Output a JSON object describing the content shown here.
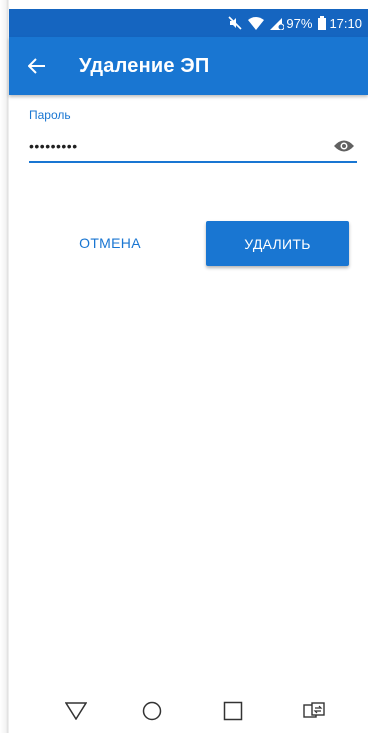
{
  "status_bar": {
    "battery_percent": "97%",
    "time": "17:10",
    "icons": [
      "mute-icon",
      "wifi-icon",
      "sim-icon",
      "battery-icon"
    ]
  },
  "app_bar": {
    "title": "Удаление ЭП",
    "back_icon": "arrow-back-icon"
  },
  "form": {
    "password_label": "Пароль",
    "password_value": "•••••••••",
    "visibility_icon": "eye-icon"
  },
  "actions": {
    "cancel_label": "ОТМЕНА",
    "delete_label": "УДАЛИТЬ"
  },
  "nav_bar": {
    "icons": [
      "back-triangle-icon",
      "home-circle-icon",
      "recents-square-icon",
      "switch-apps-icon"
    ]
  },
  "colors": {
    "primary": "#1976d2",
    "primary_dark": "#1565c0",
    "background": "#ffffff"
  }
}
